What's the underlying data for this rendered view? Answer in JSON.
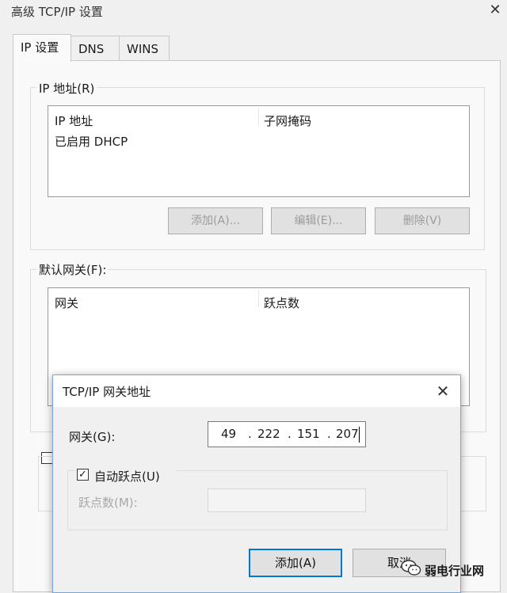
{
  "window": {
    "title": "高级 TCP/IP 设置",
    "close_glyph": "✕"
  },
  "tabs": [
    {
      "label": "IP 设置",
      "active": true
    },
    {
      "label": "DNS",
      "active": false
    },
    {
      "label": "WINS",
      "active": false
    }
  ],
  "ip_section": {
    "label": "IP 地址(R)",
    "columns": [
      "IP 地址",
      "子网掩码"
    ],
    "rows": [
      [
        "已启用 DHCP",
        ""
      ]
    ],
    "buttons": {
      "add": "添加(A)...",
      "edit": "编辑(E)...",
      "remove": "删除(V)"
    }
  },
  "gateway_section": {
    "label": "默认网关(F):",
    "columns": [
      "网关",
      "跃点数"
    ]
  },
  "dialog": {
    "title": "TCP/IP 网关地址",
    "close_glyph": "✕",
    "gateway_label": "网关(G):",
    "ip_segments": [
      "49",
      "222",
      "151",
      "207"
    ],
    "ip_dot": ".",
    "auto_metric_label": "自动跃点(U)",
    "auto_metric_checked": true,
    "metric_label": "跃点数(M):",
    "metric_value": "",
    "add_button": "添加(A)",
    "cancel_button": "取消"
  },
  "watermark": {
    "text": "弱电行业网"
  },
  "colors": {
    "accent": "#0078d7",
    "disabled_text": "#9b9b9b"
  }
}
